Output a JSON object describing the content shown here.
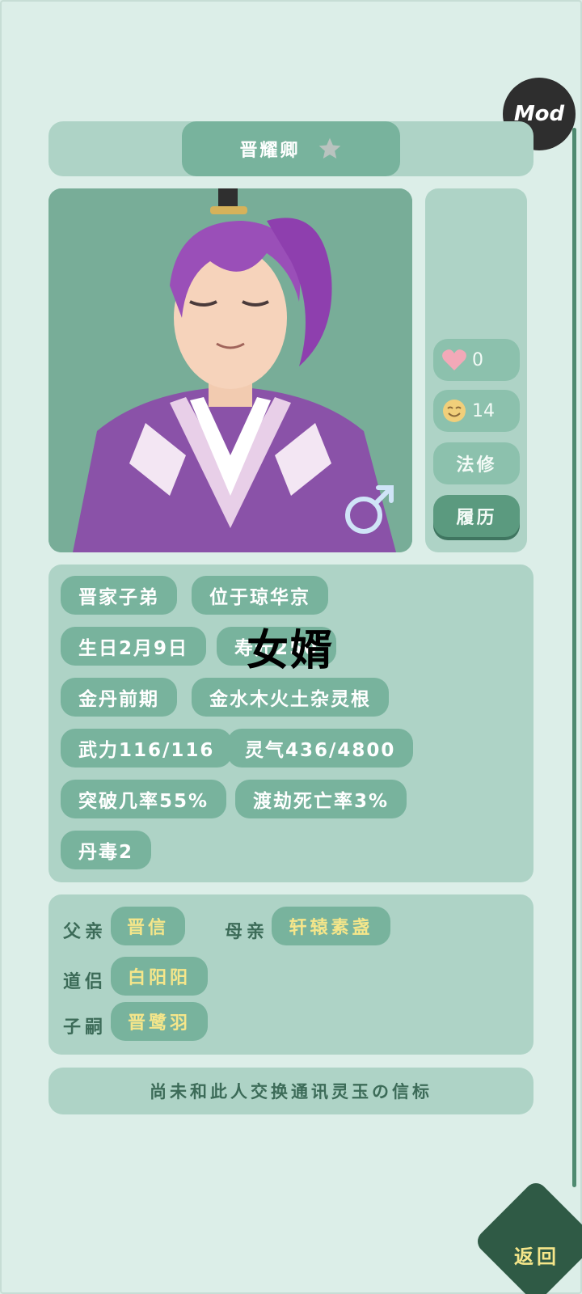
{
  "character": {
    "name": "晋耀卿",
    "gender_symbol": "♂",
    "relation_label": "女婿"
  },
  "header": {
    "mod_label": "Mod"
  },
  "side": {
    "favor": "0",
    "mood": "14",
    "class": "法修",
    "history_button": "履历"
  },
  "tags": [
    "晋家子弟",
    "位于琼华京",
    "生日2月9日",
    "寿元250",
    "金丹前期",
    "金水木火土杂灵根",
    "武力116/116",
    "灵气436/4800",
    "突破几率55%",
    "渡劫死亡率3%",
    "丹毒2"
  ],
  "family": {
    "father_label": "父亲",
    "father": "晋信",
    "mother_label": "母亲",
    "mother": "轩辕素盏",
    "partner_label": "道侣",
    "partner": "白阳阳",
    "child_label": "子嗣",
    "child": "晋鹭羽"
  },
  "footer": {
    "token_message": "尚未和此人交换通讯灵玉の信标",
    "back_label": "返回"
  },
  "colors": {
    "background": "#dceee8",
    "panel": "#aed3c6",
    "pill": "#78b39d",
    "name_highlight": "#f5e68a",
    "back_button": "#2f5a45"
  },
  "icons": {
    "favorite": "star-icon",
    "favor": "heart-icon",
    "mood": "smile-icon",
    "gender": "male-icon"
  }
}
